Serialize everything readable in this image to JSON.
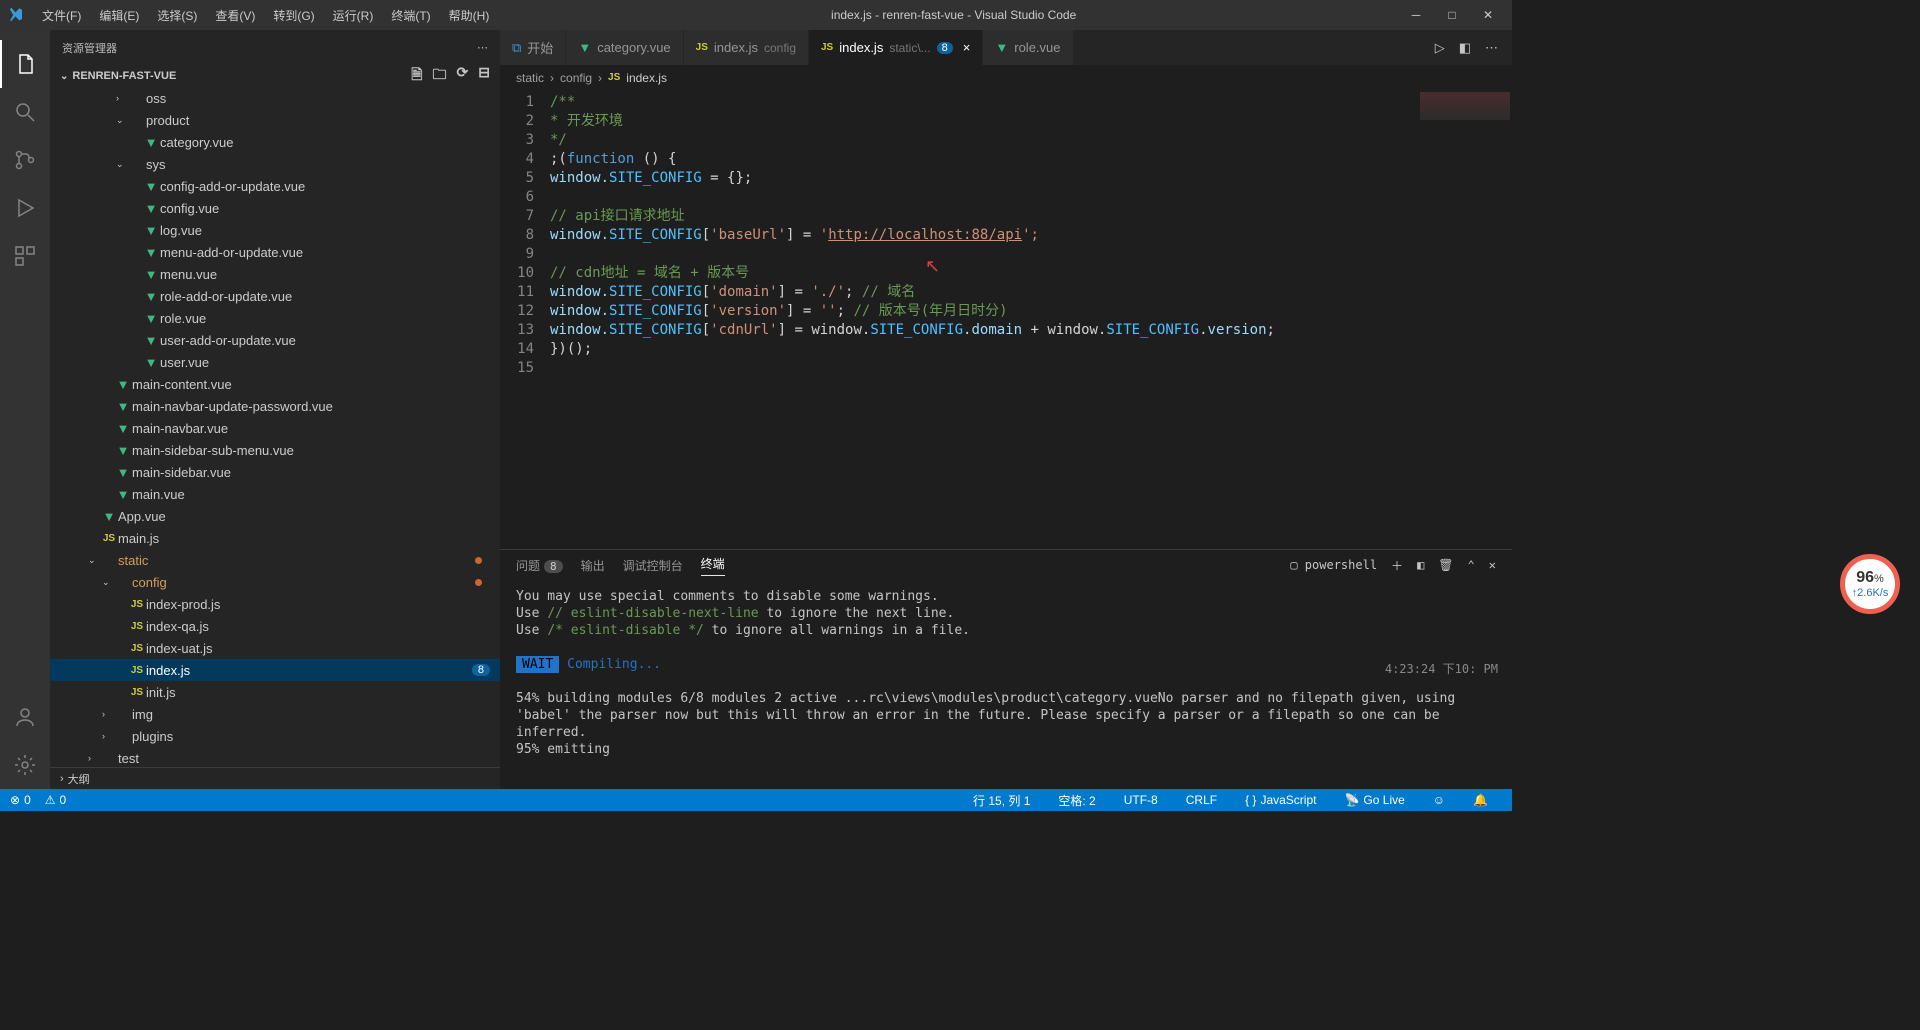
{
  "menubar": [
    "文件(F)",
    "编辑(E)",
    "选择(S)",
    "查看(V)",
    "转到(G)",
    "运行(R)",
    "终端(T)",
    "帮助(H)"
  ],
  "window_title": "index.js - renren-fast-vue - Visual Studio Code",
  "sidebar": {
    "title": "资源管理器",
    "project": "RENREN-FAST-VUE",
    "outline": "大纲",
    "items": [
      {
        "indent": 4,
        "chev": ">",
        "type": "folder",
        "label": "oss"
      },
      {
        "indent": 4,
        "chev": "v",
        "type": "folder",
        "label": "product"
      },
      {
        "indent": 5,
        "type": "vue",
        "label": "category.vue"
      },
      {
        "indent": 4,
        "chev": "v",
        "type": "folder",
        "label": "sys"
      },
      {
        "indent": 5,
        "type": "vue",
        "label": "config-add-or-update.vue"
      },
      {
        "indent": 5,
        "type": "vue",
        "label": "config.vue"
      },
      {
        "indent": 5,
        "type": "vue",
        "label": "log.vue"
      },
      {
        "indent": 5,
        "type": "vue",
        "label": "menu-add-or-update.vue"
      },
      {
        "indent": 5,
        "type": "vue",
        "label": "menu.vue"
      },
      {
        "indent": 5,
        "type": "vue",
        "label": "role-add-or-update.vue"
      },
      {
        "indent": 5,
        "type": "vue",
        "label": "role.vue"
      },
      {
        "indent": 5,
        "type": "vue",
        "label": "user-add-or-update.vue"
      },
      {
        "indent": 5,
        "type": "vue",
        "label": "user.vue"
      },
      {
        "indent": 3,
        "type": "vue",
        "label": "main-content.vue"
      },
      {
        "indent": 3,
        "type": "vue",
        "label": "main-navbar-update-password.vue"
      },
      {
        "indent": 3,
        "type": "vue",
        "label": "main-navbar.vue"
      },
      {
        "indent": 3,
        "type": "vue",
        "label": "main-sidebar-sub-menu.vue"
      },
      {
        "indent": 3,
        "type": "vue",
        "label": "main-sidebar.vue"
      },
      {
        "indent": 3,
        "type": "vue",
        "label": "main.vue"
      },
      {
        "indent": 2,
        "type": "vue",
        "label": "App.vue"
      },
      {
        "indent": 2,
        "type": "js",
        "label": "main.js"
      },
      {
        "indent": 2,
        "chev": "v",
        "type": "folder",
        "label": "static",
        "modified": "static",
        "dot": true
      },
      {
        "indent": 3,
        "chev": "v",
        "type": "folder",
        "label": "config",
        "modified": "config",
        "dot": true
      },
      {
        "indent": 4,
        "type": "js",
        "label": "index-prod.js"
      },
      {
        "indent": 4,
        "type": "js",
        "label": "index-qa.js"
      },
      {
        "indent": 4,
        "type": "js",
        "label": "index-uat.js"
      },
      {
        "indent": 4,
        "type": "js",
        "label": "index.js",
        "selected": true,
        "badge": "8"
      },
      {
        "indent": 4,
        "type": "js",
        "label": "init.js"
      },
      {
        "indent": 3,
        "chev": ">",
        "type": "folder",
        "label": "img"
      },
      {
        "indent": 3,
        "chev": ">",
        "type": "folder",
        "label": "plugins"
      },
      {
        "indent": 2,
        "chev": ">",
        "type": "folder",
        "label": "test"
      }
    ]
  },
  "tabs": [
    {
      "icon": "vs",
      "label": "开始"
    },
    {
      "icon": "vue",
      "label": "category.vue"
    },
    {
      "icon": "js",
      "label": "index.js",
      "suffix": "config",
      "dim": true
    },
    {
      "icon": "js",
      "label": "index.js",
      "suffix": "static\\...",
      "active": true,
      "badge": "8",
      "close": true
    },
    {
      "icon": "vue",
      "label": "role.vue"
    }
  ],
  "breadcrumbs": [
    "static",
    "config",
    "index.js"
  ],
  "code": {
    "lines": 15,
    "l1": "/**",
    "l2": " * 开发环境",
    "l3": " */",
    "l4a": ";(",
    "l4b": "function",
    "l4c": " () {",
    "l5a": "  window.",
    "l5b": "SITE_CONFIG",
    "l5c": " = {};",
    "l7": "  // api接口请求地址",
    "l8a": "  window.",
    "l8b": "SITE_CONFIG",
    "l8c": "[",
    "l8d": "'baseUrl'",
    "l8e": "] = ",
    "l8f": "'",
    "l8g": "http://localhost:88/api",
    "l8h": "';",
    "l10": "  // cdn地址 = 域名 + 版本号",
    "l11a": "  window.",
    "l11b": "SITE_CONFIG",
    "l11c": "[",
    "l11d": "'domain'",
    "l11e": "]  = ",
    "l11f": "'./'",
    "l11g": "; ",
    "l11h": "// 域名",
    "l12a": "  window.",
    "l12b": "SITE_CONFIG",
    "l12c": "[",
    "l12d": "'version'",
    "l12e": "] = ",
    "l12f": "''",
    "l12g": ";   ",
    "l12h": "// 版本号(年月日时分)",
    "l13a": "  window.",
    "l13b": "SITE_CONFIG",
    "l13c": "[",
    "l13d": "'cdnUrl'",
    "l13e": "]  = window.",
    "l13f": "SITE_CONFIG",
    "l13g": ".",
    "l13h": "domain",
    "l13i": " + window.",
    "l13j": "SITE_CONFIG",
    "l13k": ".",
    "l13l": "version",
    "l13m": ";",
    "l14": "})();"
  },
  "panel": {
    "tabs": {
      "problems": "问题",
      "problems_badge": "8",
      "output": "输出",
      "debug": "调试控制台",
      "terminal": "终端"
    },
    "shell": "powershell",
    "time": "4:23:24  下10: PM",
    "lines": [
      "You may use special comments to disable some warnings.",
      {
        "pre": "Use ",
        "hl": "// eslint-disable-next-line",
        "post": " to ignore the next line."
      },
      {
        "pre": "Use ",
        "hl": "/* eslint-disable */",
        "post": " to ignore all warnings in a file."
      },
      "",
      {
        "wait": "WAIT",
        "compile": " Compiling..."
      },
      "",
      " 54% building modules 6/8 modules 2 active ...rc\\views\\modules\\product\\category.vueNo parser and no filepath given, using 'babel' the parser now but this will throw an error in the future. Please specify a parser or a filepath so one can be inferred.",
      " 95% emitting"
    ]
  },
  "status": {
    "errors": "0",
    "warnings": "0",
    "errors_icon": "⊗",
    "warnings_icon": "⚠",
    "line_col": "行 15, 列 1",
    "spaces": "空格: 2",
    "encoding": "UTF-8",
    "eol": "CRLF",
    "lang": "JavaScript",
    "golive": "Go Live"
  },
  "perf": {
    "pct": "96",
    "unit": "%",
    "rate": "2.6K/s"
  },
  "problems_icon": "8"
}
